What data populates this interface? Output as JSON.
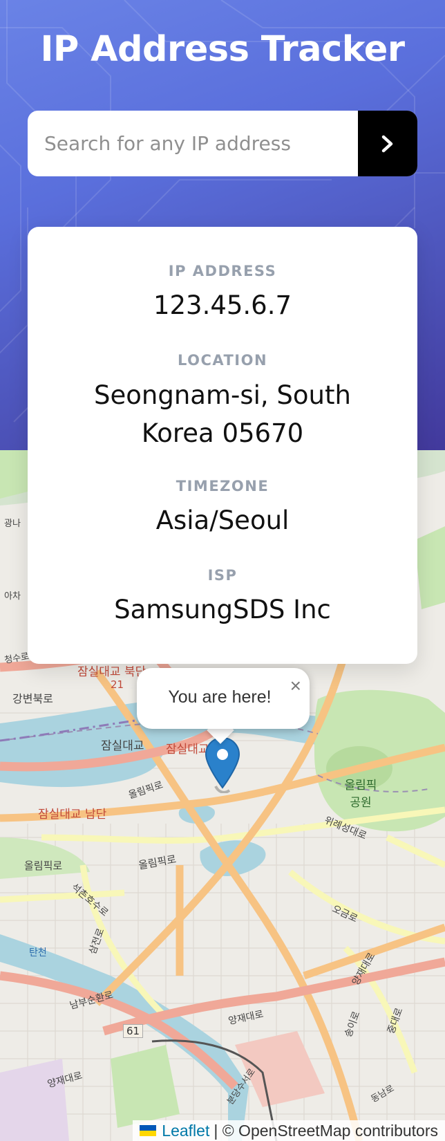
{
  "header": {
    "title": "IP Address Tracker",
    "search_placeholder": "Search for any IP address",
    "search_button_icon": "chevron-right-icon"
  },
  "info": {
    "ip_label": "IP ADDRESS",
    "ip_value": "123.45.6.7",
    "location_label": "LOCATION",
    "location_line1": "Seongnam-si, South",
    "location_line2": "Korea 05670",
    "timezone_label": "TIMEZONE",
    "timezone_value": "Asia/Seoul",
    "isp_label": "ISP",
    "isp_value": "SamsungSDS Inc"
  },
  "map": {
    "popup_text": "You are here!",
    "popup_close": "×",
    "marker_icon": "map-marker-icon",
    "attribution_link": "Leaflet",
    "attribution_text": "| © OpenStreetMap contributors",
    "labels": {
      "bridge_north": "잠실대교 북단",
      "bridge": "잠실대교",
      "bridge_south_red": "잠실대교 남단",
      "bridge_south": "잠실대교 남단",
      "park": "올림픽공원",
      "olympic_ro": "올림픽로",
      "olympic_ro_2": "올림픽로",
      "olympic_ro_3": "올림픽로",
      "gangbyeon": "강변북로",
      "route_21": "21",
      "route_61": "61",
      "seongcheon": "석촌호수로",
      "samjeon": "삼전로",
      "wirye": "위례성대로",
      "ogeum": "오금로",
      "yangjae": "양재대로",
      "yangjae_2": "양재대로",
      "yangjae_3": "양재대로",
      "nambu": "남부순환로",
      "songi": "송이로",
      "jungdae": "중대로",
      "tancheon": "탄천",
      "bundang": "분당수서로",
      "dongnam": "동남로",
      "small_1": "광나",
      "small_2": "아차",
      "small_3": "청수로"
    }
  },
  "colors": {
    "hero_top": "#6a83e6",
    "hero_bottom": "#42399c",
    "label_gray": "#97a0ad",
    "water": "#aad3df",
    "park": "#c8e6b3",
    "major_road": "#f0a898",
    "road_orange": "#f7c383",
    "road_yellow": "#f8f7b8",
    "link": "#0078a8"
  }
}
